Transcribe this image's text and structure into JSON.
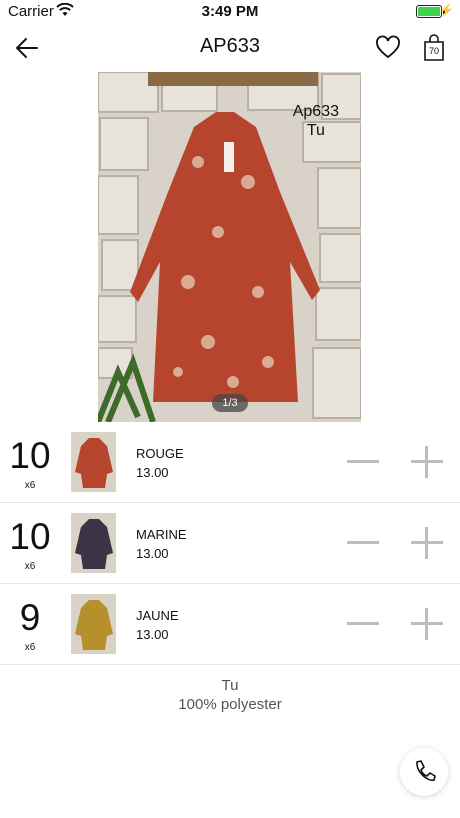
{
  "status_bar": {
    "carrier": "Carrier",
    "time": "3:49 PM"
  },
  "nav": {
    "title": "AP633",
    "cart_count": "70"
  },
  "hero": {
    "overlay_line1": "Ap633",
    "overlay_line2": "Tu",
    "pager": "1/3"
  },
  "variants": [
    {
      "qty": "10",
      "multiplier": "x6",
      "name": "ROUGE",
      "price": "13.00",
      "color": "#b7452e"
    },
    {
      "qty": "10",
      "multiplier": "x6",
      "name": "MARINE",
      "price": "13.00",
      "color": "#3b3346"
    },
    {
      "qty": "9",
      "multiplier": "x6",
      "name": "JAUNE",
      "price": "13.00",
      "color": "#b78f2b"
    }
  ],
  "description": {
    "line1": "Tu",
    "line2": "100% polyester"
  },
  "colors": {
    "battery": "#3bd44a",
    "control": "#bdbdbd",
    "divider": "#e5e5e5"
  }
}
